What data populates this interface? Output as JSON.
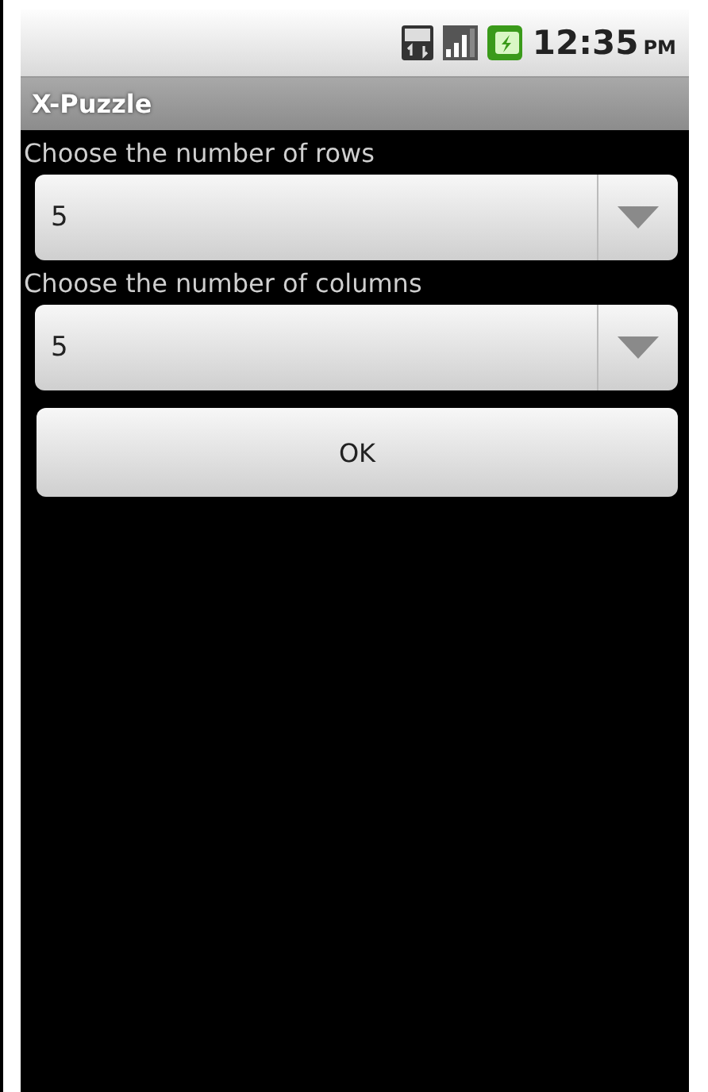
{
  "status_bar": {
    "time": "12:35",
    "ampm": "PM"
  },
  "title_bar": {
    "title": "X-Puzzle"
  },
  "form": [
    {
      "label": "Choose the number of rows",
      "value": "5"
    },
    {
      "label": "Choose the number of columns",
      "value": "5"
    }
  ],
  "buttons": [
    "OK"
  ]
}
